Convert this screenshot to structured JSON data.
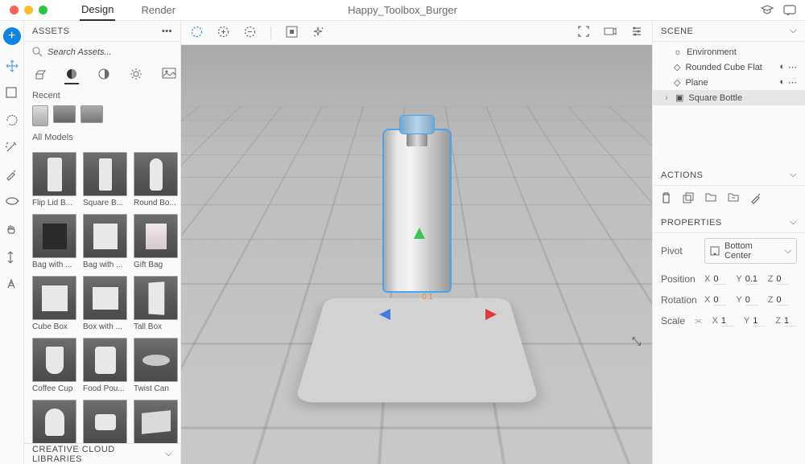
{
  "title_bar": {
    "tabs": {
      "design": "Design",
      "render": "Render"
    },
    "document": "Happy_Toolbox_Burger"
  },
  "assets": {
    "header": "ASSETS",
    "search_placeholder": "Search Assets...",
    "recent_label": "Recent",
    "all_models_label": "All Models",
    "models": [
      "Flip Lid B...",
      "Square B...",
      "Round Bo...",
      "Bag with ...",
      "Bag with ...",
      "Gift Bag",
      "Cube Box",
      "Box with ...",
      "Tall Box",
      "Coffee Cup",
      "Food Pou...",
      "Twist Can"
    ],
    "cc_libraries": "CREATIVE CLOUD LIBRARIES"
  },
  "scene": {
    "header": "SCENE",
    "items": [
      {
        "label": "Environment",
        "selected": false
      },
      {
        "label": "Rounded Cube Flat",
        "selected": false
      },
      {
        "label": "Plane",
        "selected": false
      },
      {
        "label": "Square Bottle",
        "selected": true
      }
    ]
  },
  "actions": {
    "header": "ACTIONS"
  },
  "properties": {
    "header": "PROPERTIES",
    "pivot_label": "Pivot",
    "pivot_value": "Bottom Center",
    "rows": {
      "position": {
        "label": "Position",
        "x": "0",
        "y": "0.1",
        "z": "0"
      },
      "rotation": {
        "label": "Rotation",
        "x": "0",
        "y": "0",
        "z": "0"
      },
      "scale": {
        "label": "Scale",
        "x": "1",
        "y": "1",
        "z": "1"
      }
    },
    "axis": {
      "x": "X",
      "y": "Y",
      "z": "Z"
    }
  },
  "gizmo": {
    "readout": "0.1"
  }
}
